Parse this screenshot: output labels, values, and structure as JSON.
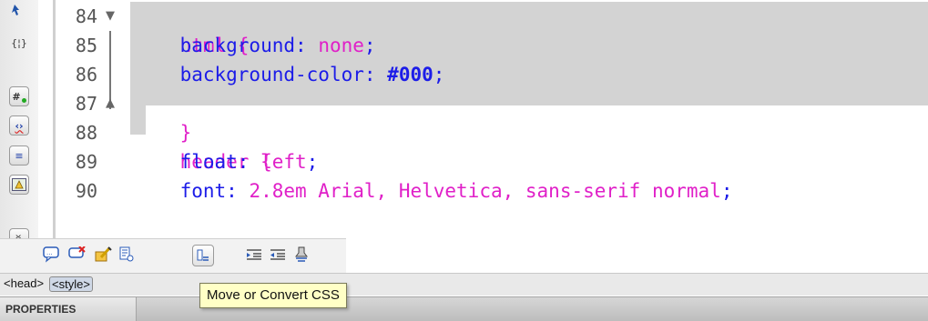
{
  "code_editor": {
    "lines": [
      {
        "number": "84",
        "fold": "▼",
        "text": "html {",
        "selected": true
      },
      {
        "number": "85",
        "fold": "",
        "prop": "background",
        "value": "none",
        "selected": true
      },
      {
        "number": "86",
        "fold": "",
        "prop": "background-color",
        "value": "#000",
        "selected": true
      },
      {
        "number": "87",
        "fold": "▲",
        "text": "}",
        "selected": true
      },
      {
        "number": "88",
        "fold": "",
        "text": "header {",
        "selected": false
      },
      {
        "number": "89",
        "fold": "",
        "prop": "float",
        "value": "left",
        "selected": false
      },
      {
        "number": "90",
        "fold": "",
        "prop": "font",
        "value": "2.8em Arial, Helvetica, sans-serif normal",
        "selected": false
      }
    ]
  },
  "coding_toolbar": {
    "icons": [
      "pointer-icon",
      "collapse-braces-icon",
      "line-numbers-icon",
      "highlight-invalid-code-icon",
      "word-wrap-icon",
      "info-icon",
      "expand-toolbar-icon"
    ],
    "glyphs": {
      "braces": "{¦}",
      "hash": "#",
      "tag": "‹›",
      "wrap": "≡",
      "chevron": "»"
    }
  },
  "bottom_toolbar": {
    "icons": [
      "apply-comment-icon",
      "remove-comment-icon",
      "wrap-tag-icon",
      "recent-snippets-icon",
      "move-convert-css-icon",
      "indent-code-icon",
      "outdent-code-icon",
      "format-source-icon"
    ]
  },
  "tag_selector": {
    "tags": [
      "<head>",
      "<style>"
    ]
  },
  "properties_panel": {
    "title": "PROPERTIES"
  },
  "tooltip": {
    "text": "Move or Convert CSS"
  },
  "colors": {
    "selector": "#e020c8",
    "property": "#1c1ce8",
    "value": "#e020c8",
    "hex_value": "#1c1ce8",
    "selection": "#d3d3d3",
    "tooltip_bg": "#ffffc6"
  }
}
